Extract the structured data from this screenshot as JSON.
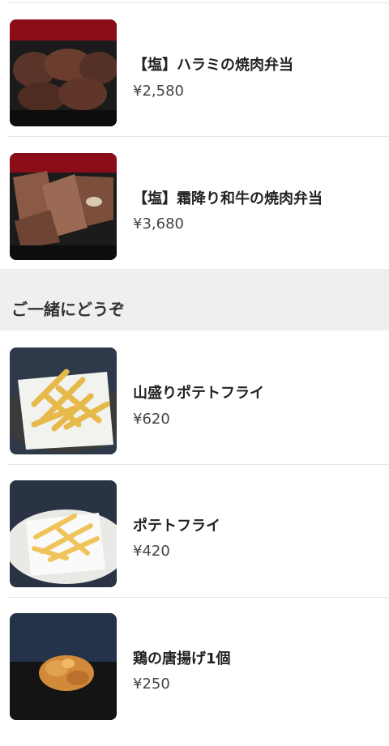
{
  "items_top": [
    {
      "name": "【塩】ハラミの焼肉弁当",
      "price": "¥2,580",
      "image": "bento-harami-image"
    },
    {
      "name": "【塩】霜降り和牛の焼肉弁当",
      "price": "¥3,680",
      "image": "bento-wagyu-image"
    }
  ],
  "section": {
    "title": "ご一緒にどうぞ"
  },
  "items_bottom": [
    {
      "name": "山盛りポテトフライ",
      "price": "¥620",
      "image": "fries-large-image"
    },
    {
      "name": "ポテトフライ",
      "price": "¥420",
      "image": "fries-image"
    },
    {
      "name": "鶏の唐揚げ1個",
      "price": "¥250",
      "image": "karaage-image"
    }
  ]
}
